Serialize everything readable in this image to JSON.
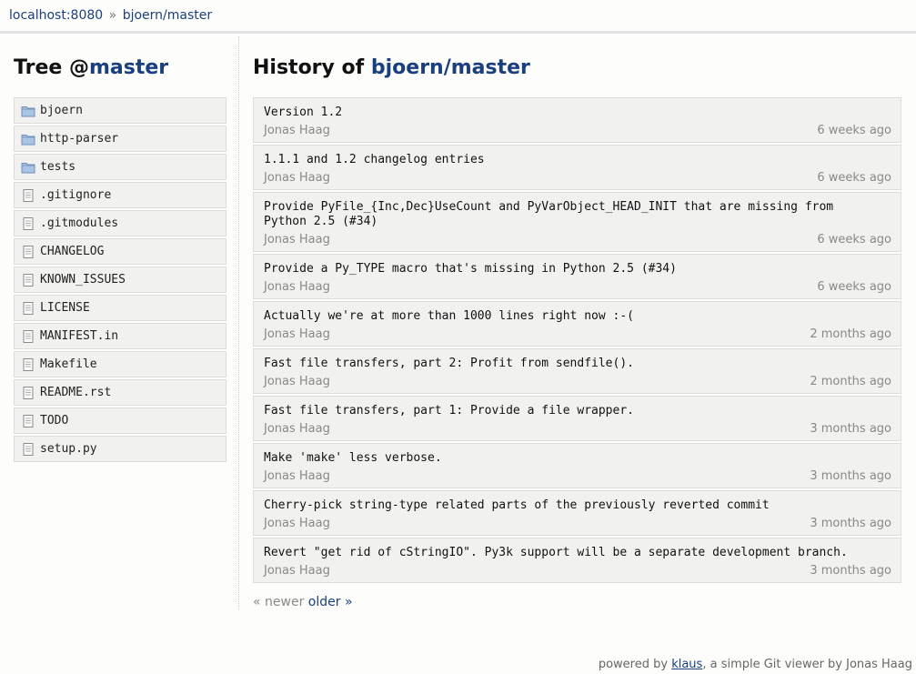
{
  "breadcrumb": {
    "host": "localhost:8080",
    "separator": "»",
    "repo": "bjoern/master"
  },
  "tree": {
    "title_prefix": "Tree @",
    "title_ref": "master",
    "items": [
      {
        "name": "bjoern",
        "type": "folder"
      },
      {
        "name": "http-parser",
        "type": "folder"
      },
      {
        "name": "tests",
        "type": "folder"
      },
      {
        "name": ".gitignore",
        "type": "file"
      },
      {
        "name": ".gitmodules",
        "type": "file"
      },
      {
        "name": "CHANGELOG",
        "type": "file"
      },
      {
        "name": "KNOWN_ISSUES",
        "type": "file"
      },
      {
        "name": "LICENSE",
        "type": "file"
      },
      {
        "name": "MANIFEST.in",
        "type": "file"
      },
      {
        "name": "Makefile",
        "type": "file"
      },
      {
        "name": "README.rst",
        "type": "file"
      },
      {
        "name": "TODO",
        "type": "file"
      },
      {
        "name": "setup.py",
        "type": "file"
      }
    ]
  },
  "history": {
    "title_prefix": "History of ",
    "title_ref": "bjoern/master",
    "commits": [
      {
        "message": "Version 1.2",
        "author": "Jonas Haag",
        "age": "6 weeks ago"
      },
      {
        "message": "1.1.1 and 1.2 changelog entries",
        "author": "Jonas Haag",
        "age": "6 weeks ago"
      },
      {
        "message": "Provide PyFile_{Inc,Dec}UseCount and PyVarObject_HEAD_INIT that are missing from\nPython 2.5 (#34)",
        "author": "Jonas Haag",
        "age": "6 weeks ago"
      },
      {
        "message": "Provide a Py_TYPE macro that's missing in Python 2.5 (#34)",
        "author": "Jonas Haag",
        "age": "6 weeks ago"
      },
      {
        "message": "Actually we're at more than 1000 lines right now :-(",
        "author": "Jonas Haag",
        "age": "2 months ago"
      },
      {
        "message": "Fast file transfers, part 2: Profit from sendfile().",
        "author": "Jonas Haag",
        "age": "2 months ago"
      },
      {
        "message": "Fast file transfers, part 1: Provide a file wrapper.",
        "author": "Jonas Haag",
        "age": "3 months ago"
      },
      {
        "message": "Make 'make' less verbose.",
        "author": "Jonas Haag",
        "age": "3 months ago"
      },
      {
        "message": "Cherry-pick string-type related parts of the previously reverted commit",
        "author": "Jonas Haag",
        "age": "3 months ago"
      },
      {
        "message": "Revert \"get rid of cStringIO\". Py3k support will be a separate development branch.",
        "author": "Jonas Haag",
        "age": "3 months ago"
      }
    ]
  },
  "pager": {
    "newer": "« newer",
    "older": "older »"
  },
  "footer": {
    "prefix": "powered by ",
    "link": "klaus",
    "suffix": ", a simple Git viewer by Jonas Haag"
  }
}
